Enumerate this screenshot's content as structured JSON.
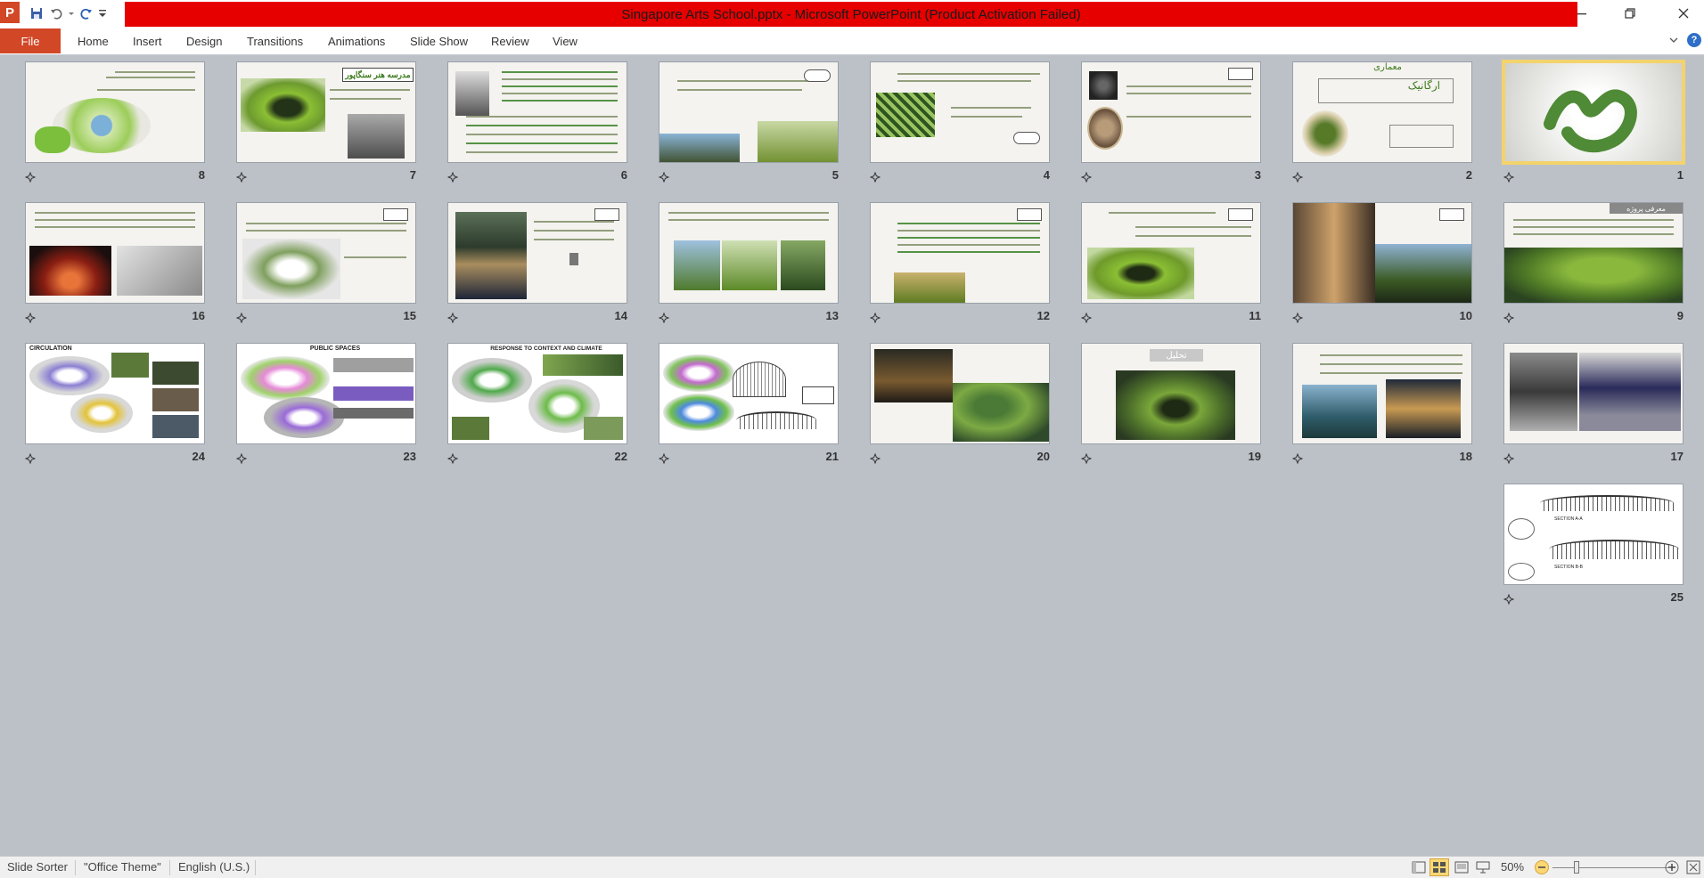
{
  "window": {
    "title": "Singapore Arts School.pptx - Microsoft PowerPoint (Product Activation Failed)",
    "app_icon_letter": "P"
  },
  "ribbon": {
    "file": "File",
    "tabs": [
      "Home",
      "Insert",
      "Design",
      "Transitions",
      "Animations",
      "Slide Show",
      "Review",
      "View"
    ]
  },
  "slides": [
    {
      "num": "8"
    },
    {
      "num": "7"
    },
    {
      "num": "6"
    },
    {
      "num": "5"
    },
    {
      "num": "4"
    },
    {
      "num": "3"
    },
    {
      "num": "2"
    },
    {
      "num": "1"
    },
    {
      "num": "16"
    },
    {
      "num": "15"
    },
    {
      "num": "14"
    },
    {
      "num": "13"
    },
    {
      "num": "12"
    },
    {
      "num": "11"
    },
    {
      "num": "10"
    },
    {
      "num": "9"
    },
    {
      "num": "24"
    },
    {
      "num": "23"
    },
    {
      "num": "22"
    },
    {
      "num": "21"
    },
    {
      "num": "20"
    },
    {
      "num": "19"
    },
    {
      "num": "18"
    },
    {
      "num": "17"
    },
    {
      "num": "25"
    }
  ],
  "slide_text": {
    "s7_label": "مدرسه هنر سنگاپور",
    "s2_title": "معماری",
    "s2_sub": "ارگانیک",
    "s9_label": "معرفی پروژه",
    "s19_label": "تحلیل",
    "s24_label": "CIRCULATION",
    "s23_label": "PUBLIC SPACES",
    "s22_label": "RESPONSE TO CONTEXT AND CLIMATE",
    "s25_a": "SECTION A-A",
    "s25_b": "SECTION B-B"
  },
  "status": {
    "view": "Slide Sorter",
    "theme": "\"Office Theme\"",
    "language": "English (U.S.)",
    "zoom": "50%"
  },
  "colors": {
    "accent": "#d24726",
    "title_banner": "#e60000",
    "selection": "#f3d36b"
  }
}
